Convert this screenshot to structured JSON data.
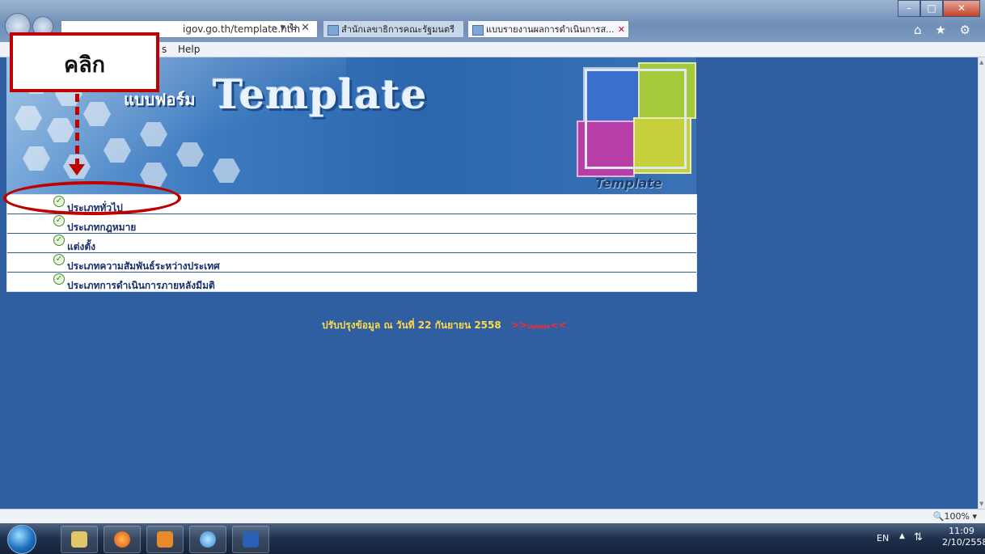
{
  "browser": {
    "url_text": "igov.go.th/template.htm",
    "address_tools": "⌕ ▾ ↻ ✕",
    "tabs": [
      {
        "label": "สำนักเลขาธิการคณะรัฐมนตรี"
      },
      {
        "label": "แบบรายงานผลการดำเนินการส...",
        "close": "✕"
      }
    ],
    "menu": {
      "tools_fragment": "s",
      "help": "Help"
    },
    "toolbar_icons": "⌂ ★ ⚙",
    "window_controls": {
      "min": "–",
      "max": "□",
      "close": "✕"
    },
    "zoom": "🔍100% ▾"
  },
  "page": {
    "banner": {
      "thai_title": "แบบฟอร์ม",
      "big_title": "Template",
      "puzzle_label": "Template"
    },
    "menu_items": [
      {
        "label": "ประเภททั่วไป"
      },
      {
        "label": "ประเภทกฎหมาย"
      },
      {
        "label": "แต่งตั้ง"
      },
      {
        "label": "ประเภทความสัมพันธ์ระหว่างประเทศ"
      },
      {
        "label": "ประเภทการดำเนินการภายหลังมีมติ"
      }
    ],
    "update_text": "ปรับปรุงข้อมูล ณ วันที่ 22 กันยายน 2558",
    "update_link_left": ">>",
    "update_link_mid": "Update",
    "update_link_right": "<<"
  },
  "annotation": {
    "callout_text": "คลิก",
    "color": "#c00000"
  },
  "taskbar": {
    "language": "EN",
    "time": "11:09",
    "date": "2/10/2558",
    "apps": [
      "start-orb",
      "file-explorer",
      "firefox",
      "media-player",
      "internet-explorer",
      "word"
    ]
  },
  "colors": {
    "page_bg": "#2f5fa0",
    "menu_text": "#1a2f6b",
    "update_text": "#ffd94a",
    "update_link": "#ff2a2a"
  }
}
